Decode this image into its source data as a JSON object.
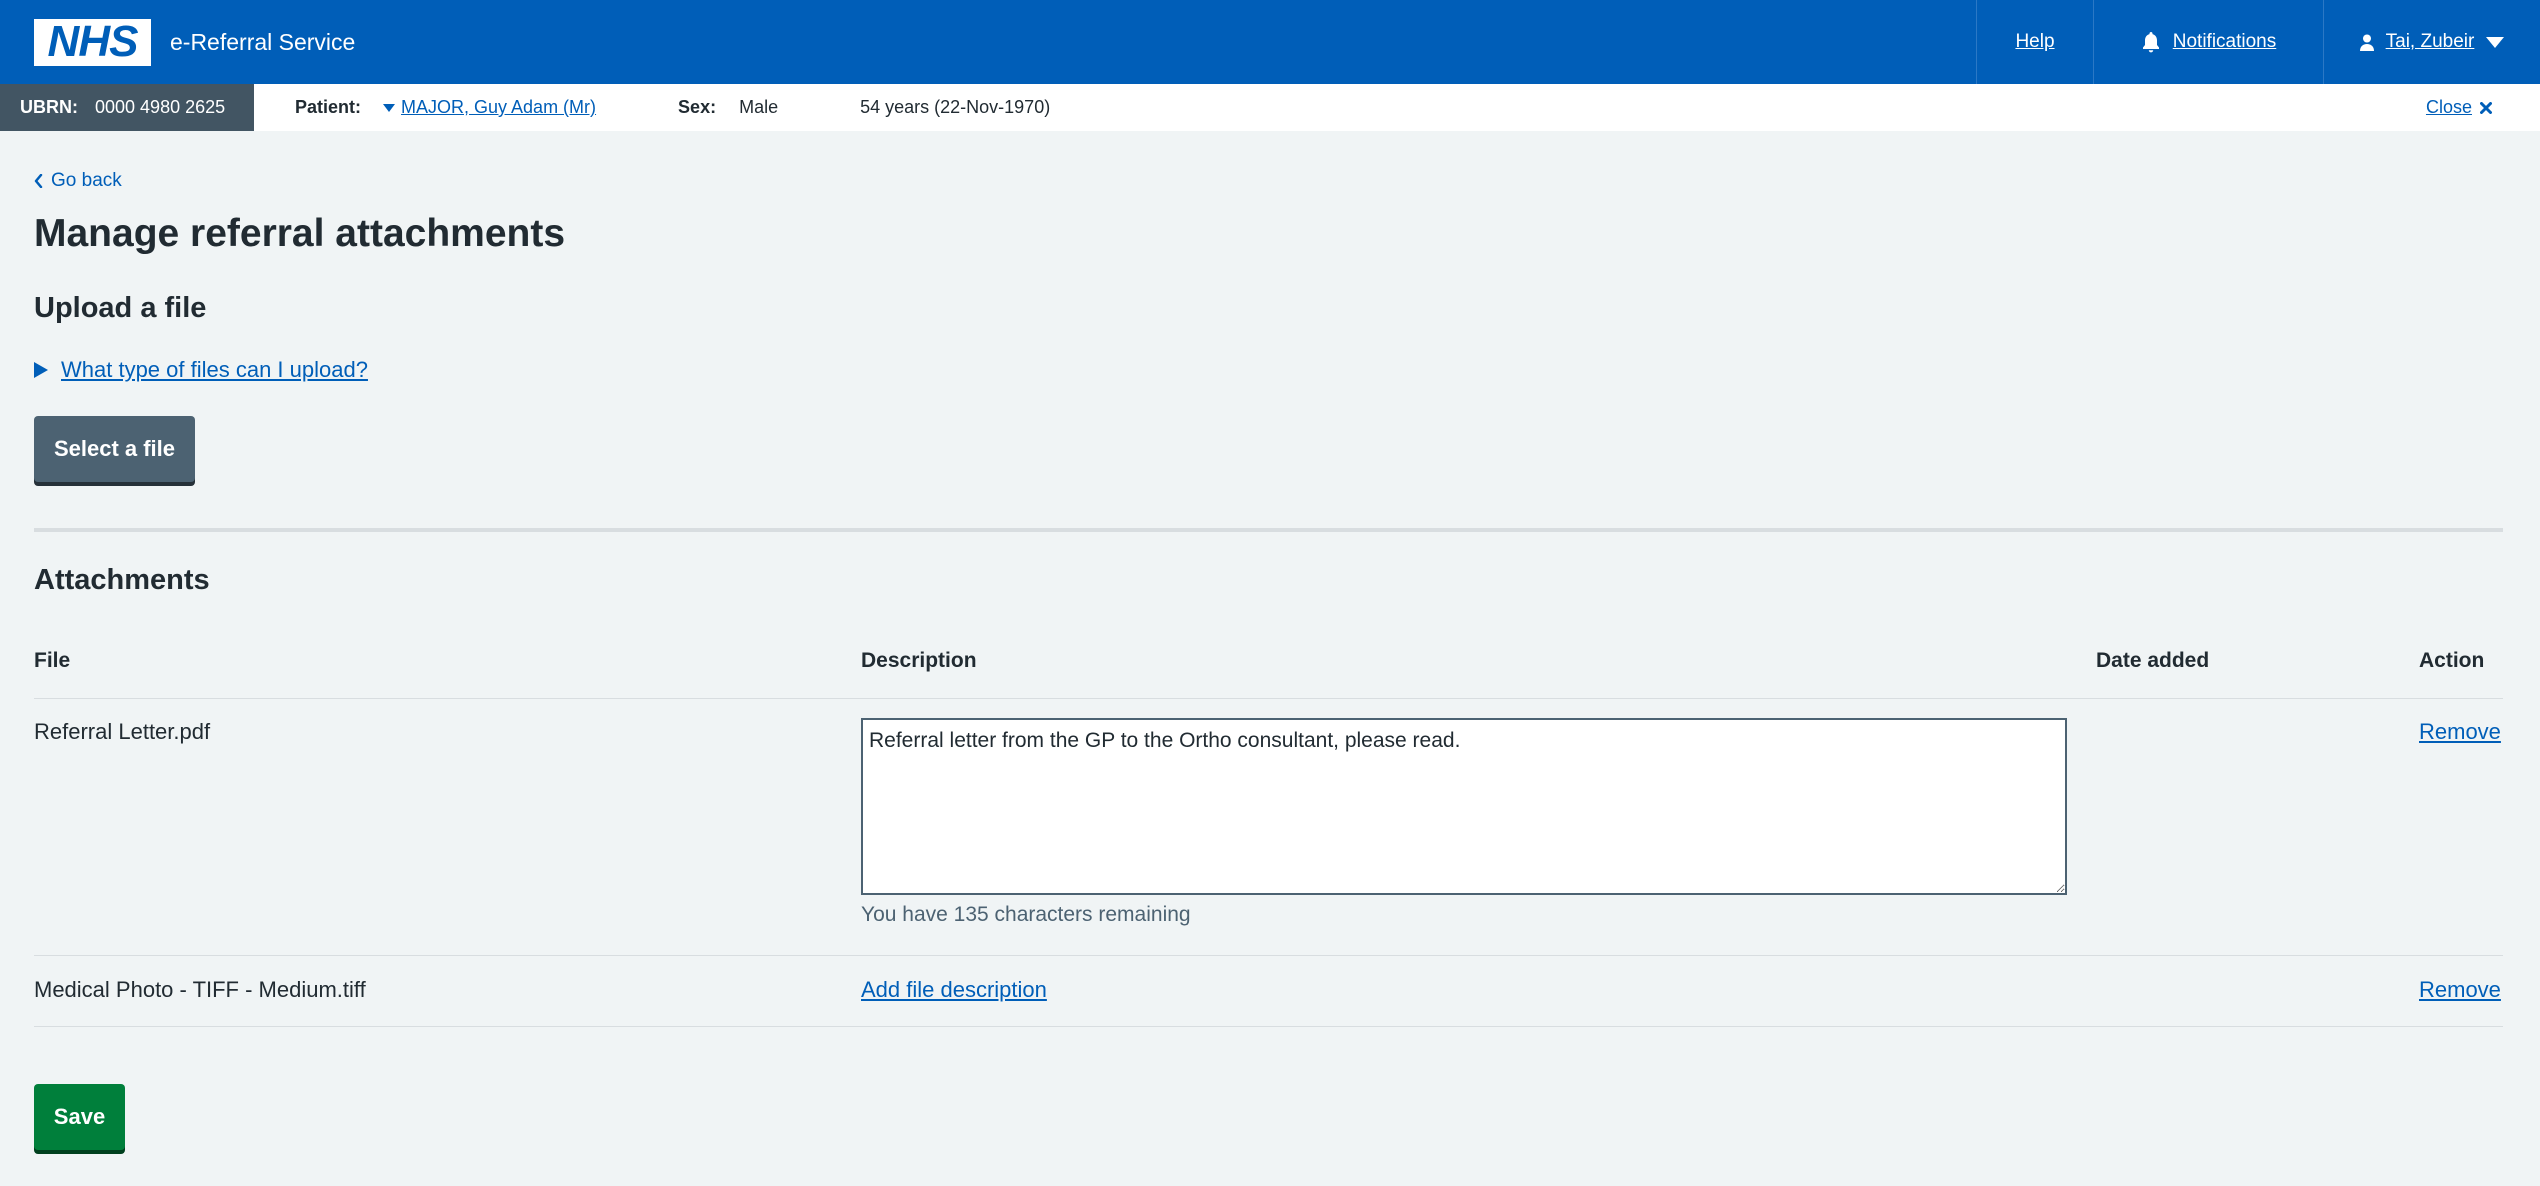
{
  "header": {
    "logo_text": "NHS",
    "service_name": "e-Referral Service",
    "help": "Help",
    "notifications": "Notifications",
    "user": "Tai, Zubeir"
  },
  "banner": {
    "ubrn_label": "UBRN:",
    "ubrn_value": "0000 4980 2625",
    "patient_label": "Patient:",
    "patient_name": "MAJOR, Guy Adam (Mr)",
    "sex_label": "Sex:",
    "sex_value": "Male",
    "age": "54 years (22-Nov-1970)",
    "close": "Close"
  },
  "page": {
    "back": "Go back",
    "title": "Manage referral attachments",
    "upload_heading": "Upload a file",
    "file_types_link": "What type of files can I upload?",
    "select_button": "Select a file",
    "attachments_heading": "Attachments",
    "save_button": "Save"
  },
  "table": {
    "headers": {
      "file": "File",
      "description": "Description",
      "date_added": "Date added",
      "action": "Action"
    },
    "rows": [
      {
        "file": "Referral Letter.pdf",
        "description": "Referral letter from the GP to the Ortho consultant, please read.",
        "hint": "You have 135 characters remaining",
        "action": "Remove"
      },
      {
        "file": "Medical Photo - TIFF - Medium.tiff",
        "add_description": "Add file description",
        "action": "Remove"
      }
    ]
  },
  "colors": {
    "nhs_blue": "#005eb8",
    "page_bg": "#f0f4f5",
    "secondary_button": "#4c6272",
    "save_green": "#007f3b"
  },
  "icons": [
    "bell-icon",
    "user-icon",
    "chevron-down-icon",
    "caret-down-icon",
    "close-icon",
    "chevron-left-icon",
    "triangle-right-icon"
  ]
}
